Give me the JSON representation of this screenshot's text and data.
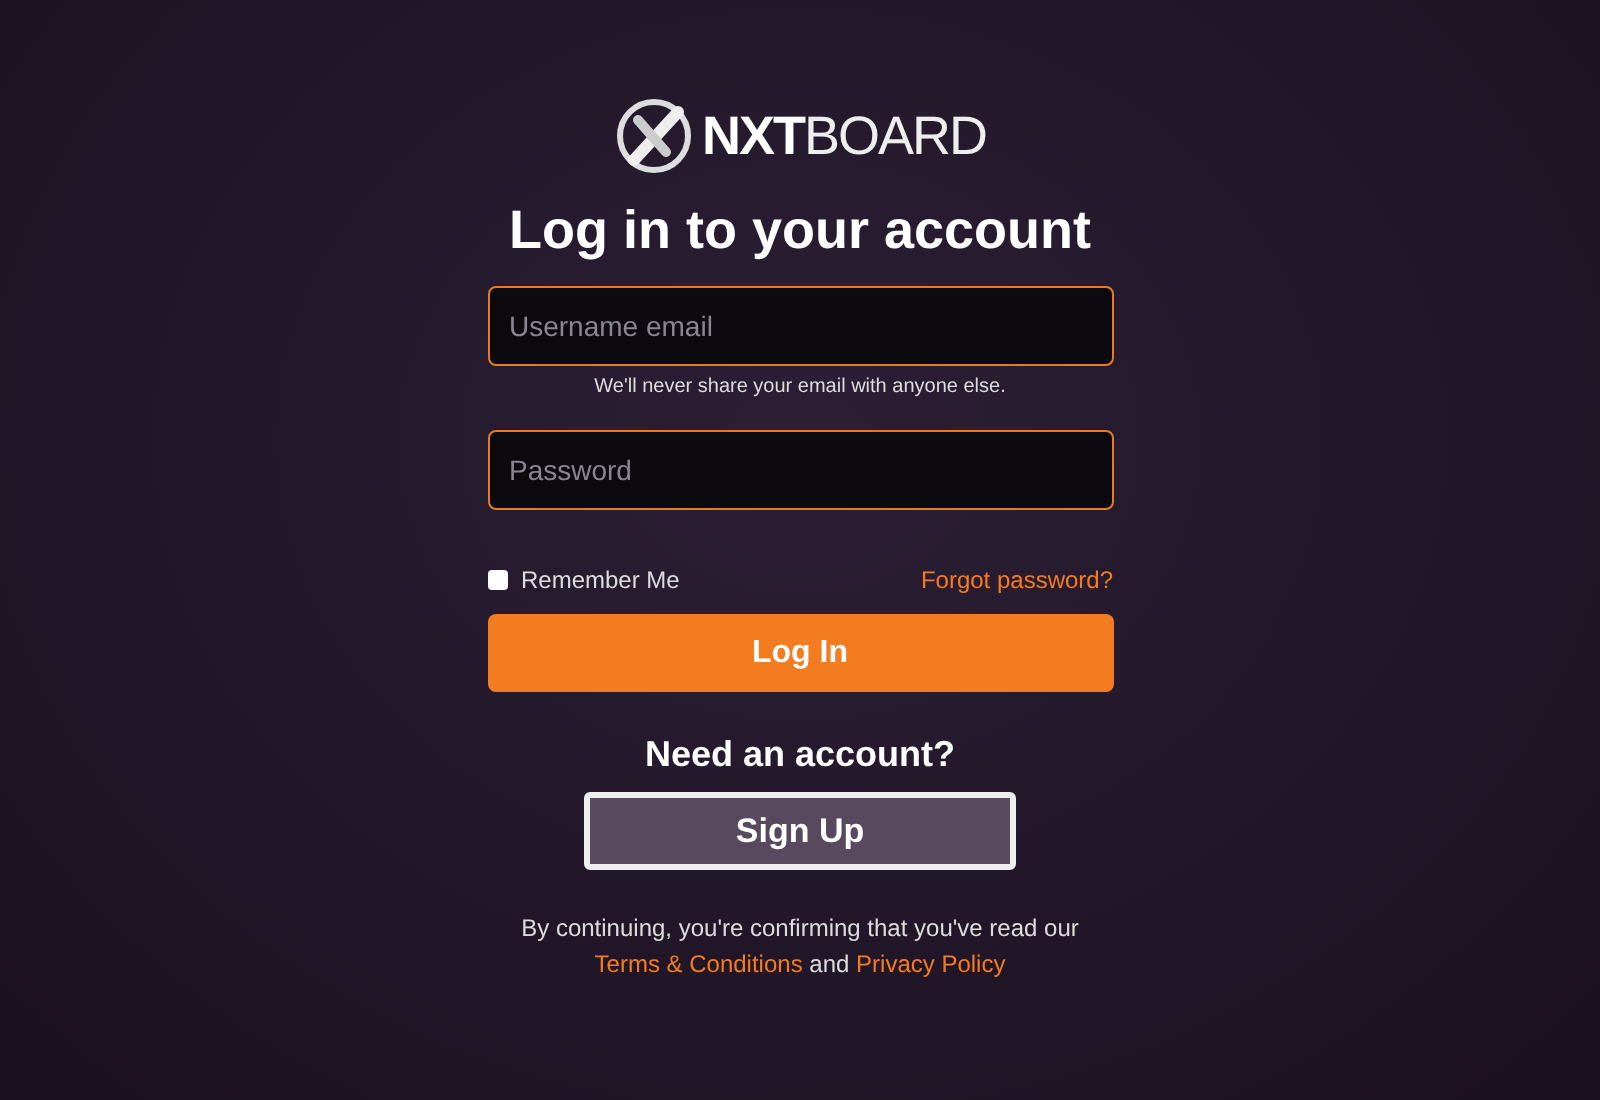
{
  "logo": {
    "text": "**NXT**BOARD"
  },
  "heading": "Log in to your account",
  "username": {
    "placeholder": "Username email",
    "help": "We'll never share your email with anyone else."
  },
  "password": {
    "placeholder": "Password"
  },
  "remember": {
    "label": "Remember Me",
    "checked": false
  },
  "forgot_link": "Forgot password?",
  "login_button": "Log In",
  "signup_prompt": "Need an account?",
  "signup_button": "Sign Up",
  "legal": {
    "text": "By continuing, you're confirming that you've read our",
    "terms_link": "Terms & Conditions",
    "joiner": "and",
    "privacy_link": "Privacy Policy"
  }
}
